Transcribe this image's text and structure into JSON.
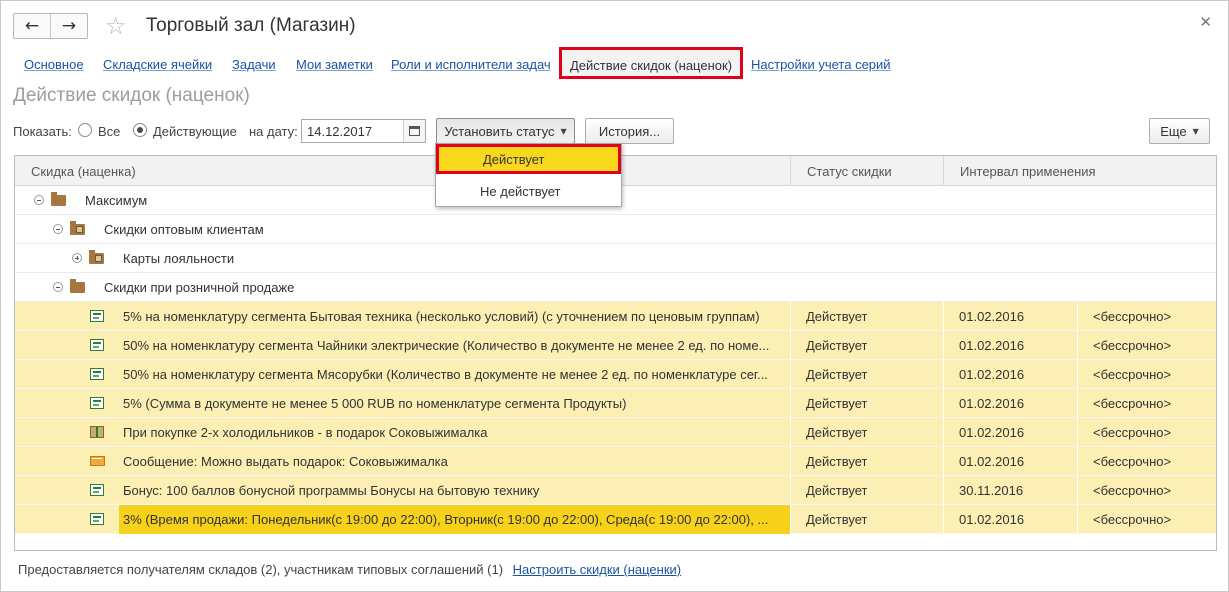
{
  "window": {
    "title": "Торговый зал (Магазин)"
  },
  "tabs": [
    {
      "label": "Основное"
    },
    {
      "label": "Складские ячейки"
    },
    {
      "label": "Задачи"
    },
    {
      "label": "Мои заметки"
    },
    {
      "label": "Роли и исполнители задач"
    },
    {
      "label": "Действие скидок (наценок)",
      "active": true
    },
    {
      "label": "Настройки учета серий"
    }
  ],
  "section_title": "Действие скидок (наценок)",
  "filter": {
    "show_label": "Показать:",
    "option_all": "Все",
    "option_active": "Действующие",
    "selected": "Действующие",
    "date_label": "на дату:",
    "date_value": "14.12.2017"
  },
  "buttons": {
    "set_status": "Установить статус",
    "history": "История...",
    "more": "Еще"
  },
  "status_menu": {
    "items": [
      "Действует",
      "Не действует"
    ],
    "selected": "Действует"
  },
  "table": {
    "columns": [
      "Скидка (наценка)",
      "Статус скидки",
      "Интервал применения"
    ],
    "groups": [
      {
        "label": "Максимум"
      },
      {
        "label": "Скидки оптовым клиентам"
      },
      {
        "label": "Карты лояльности"
      },
      {
        "label": "Скидки при розничной продаже"
      }
    ],
    "rows": [
      {
        "name": "5% на номенклатуру сегмента Бытовая техника (несколько условий) (с уточнением по ценовым группам)",
        "status": "Действует",
        "from": "01.02.2016",
        "to": "<бессрочно>",
        "icon": "discount-icon"
      },
      {
        "name": "50% на номенклатуру сегмента Чайники электрические (Количество в документе не менее 2 ед. по номе...",
        "status": "Действует",
        "from": "01.02.2016",
        "to": "<бессрочно>",
        "icon": "discount-icon"
      },
      {
        "name": "50% на номенклатуру сегмента Мясорубки (Количество в документе не менее 2 ед. по номенклатуре сег...",
        "status": "Действует",
        "from": "01.02.2016",
        "to": "<бессрочно>",
        "icon": "discount-icon"
      },
      {
        "name": "5% (Сумма в документе не менее 5 000 RUB по номенклатуре сегмента Продукты)",
        "status": "Действует",
        "from": "01.02.2016",
        "to": "<бессрочно>",
        "icon": "discount-icon"
      },
      {
        "name": "При покупке 2-х холодильников - в подарок Соковыжималка",
        "status": "Действует",
        "from": "01.02.2016",
        "to": "<бессрочно>",
        "icon": "gift-icon"
      },
      {
        "name": "Сообщение: Можно выдать подарок: Соковыжималка",
        "status": "Действует",
        "from": "01.02.2016",
        "to": "<бессрочно>",
        "icon": "message-icon"
      },
      {
        "name": "Бонус: 100 баллов бонусной программы Бонусы на бытовую технику",
        "status": "Действует",
        "from": "30.11.2016",
        "to": "<бессрочно>",
        "icon": "discount-icon"
      },
      {
        "name": "3% (Время продажи: Понедельник(с 19:00 до 22:00), Вторник(с 19:00 до 22:00), Среда(с 19:00 до 22:00), ...",
        "status": "Действует",
        "from": "01.02.2016",
        "to": "<бессрочно>",
        "icon": "discount-icon",
        "selected": true
      }
    ]
  },
  "footer": {
    "text": "Предоставляется получателям складов (2), участникам типовых соглашений (1)",
    "link": "Настроить скидки (наценки)"
  }
}
